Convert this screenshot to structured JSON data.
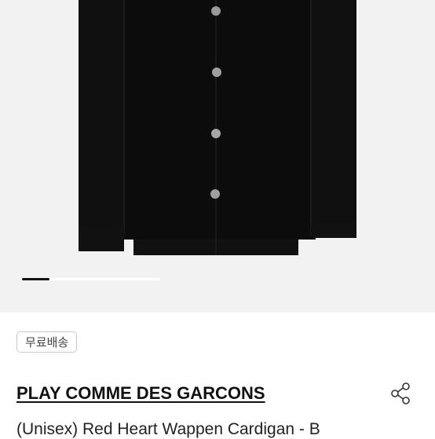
{
  "carousel": {
    "progress": 0.2
  },
  "product": {
    "shipping_badge": "무료배송",
    "brand": "PLAY COMME DES GARCONS",
    "name": "(Unisex) Red Heart Wappen Cardigan - B"
  },
  "icons": {
    "share": "share-icon"
  },
  "colors": {
    "background": "#f2f2f2",
    "garment": "#0c0c0c",
    "text": "#111111"
  }
}
